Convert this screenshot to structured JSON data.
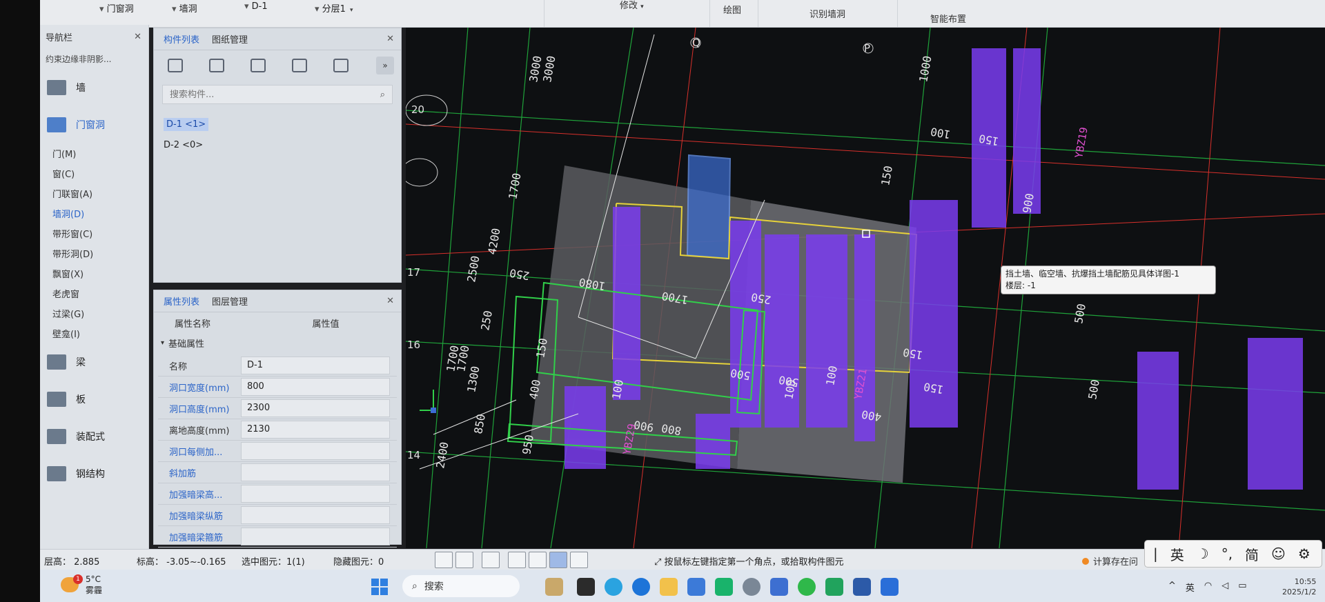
{
  "ribbon": {
    "category_value": "门窗洞",
    "type_value": "墙洞",
    "component_value": "D-1",
    "layer_value": "分层1",
    "group_modify": "修改",
    "group_draw": "绘图",
    "group_recognize": "识别墙洞",
    "group_smart": "智能布置"
  },
  "nav": {
    "title": "导航栏",
    "subtitle": "约束边缘非阴影...",
    "wall_label": "墙",
    "door_window_label": "门窗洞",
    "items": [
      "门(M)",
      "窗(C)",
      "门联窗(A)",
      "墙洞(D)",
      "带形窗(C)",
      "带形洞(D)",
      "飘窗(X)",
      "老虎窗",
      "过梁(G)",
      "壁龛(I)"
    ],
    "beam_label": "梁",
    "slab_label": "板",
    "prefab_label": "装配式",
    "steel_label": "钢结构"
  },
  "component_panel": {
    "tab_list": "构件列表",
    "tab_drawing": "图纸管理",
    "search_placeholder": "搜索构件...",
    "components": [
      "D-1 <1>",
      "D-2 <0>"
    ],
    "more_label": "»"
  },
  "property_panel": {
    "tab_props": "属性列表",
    "tab_layers": "图层管理",
    "col_name": "属性名称",
    "col_value": "属性值",
    "group_basic": "基础属性",
    "rows": [
      {
        "name": "名称",
        "value": "D-1"
      },
      {
        "name": "洞口宽度(mm)",
        "value": "800"
      },
      {
        "name": "洞口高度(mm)",
        "value": "2300"
      },
      {
        "name": "离地高度(mm)",
        "value": "2130"
      },
      {
        "name": "洞口每侧加...",
        "value": ""
      },
      {
        "name": "斜加筋",
        "value": ""
      },
      {
        "name": "加强暗梁高...",
        "value": ""
      },
      {
        "name": "加强暗梁纵筋",
        "value": ""
      },
      {
        "name": "加强暗梁箍筋",
        "value": ""
      }
    ]
  },
  "viewport": {
    "axis_q": "Q",
    "axis_p": "P",
    "axis_20": "20",
    "axis_17": "17",
    "axis_16": "16",
    "axis_14": "14",
    "dims": [
      "3000",
      "3000",
      "1700",
      "4200",
      "2500",
      "250",
      "1080",
      "1700",
      "1700",
      "1700",
      "1300",
      "250",
      "150",
      "400",
      "850",
      "2400",
      "950",
      "100",
      "900",
      "800",
      "500",
      "500",
      "250",
      "100",
      "100",
      "400",
      "150",
      "100",
      "150",
      "1000",
      "150",
      "500",
      "900",
      "500",
      "150"
    ],
    "labels": [
      "YBZ19",
      "YBZ21",
      "YBZ29"
    ],
    "tooltip_line1": "挡土墙、临空墙、抗爆挡土墙配筋见具体详图-1",
    "tooltip_line2": "楼层: -1"
  },
  "status": {
    "floor_height": "层高： 2.885",
    "elevation": "标高： -3.05~-0.165",
    "selected": "选中图元：1(1)",
    "hidden": "隐藏图元：0",
    "hint": "按鼠标左键指定第一个角点，或拾取构件图元",
    "calc": "计算存在问"
  },
  "ime": {
    "lang": "英",
    "mode": "简"
  },
  "taskbar": {
    "temp": "5°C",
    "weather": "雾霾",
    "badge": "1",
    "search": "搜索",
    "tray_lang": "英",
    "time": "10:55",
    "date": "2025/1/2"
  }
}
